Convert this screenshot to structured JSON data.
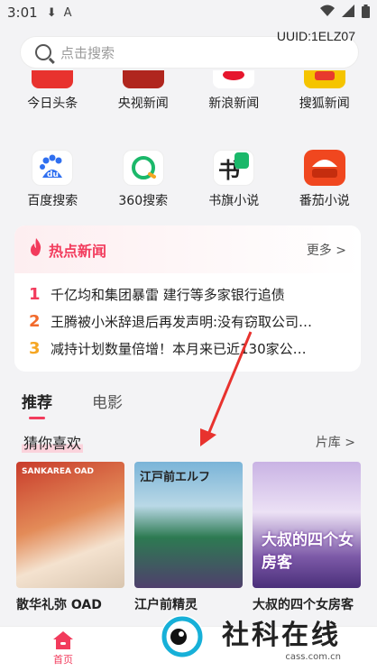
{
  "status_bar": {
    "time": "3:01",
    "download_icon": "download-icon",
    "a_icon": "A"
  },
  "search": {
    "placeholder": "点击搜索",
    "uuid": "UUID:1ELZ07"
  },
  "row1": [
    {
      "label": "今日头条",
      "color": "#e8322e",
      "glyph": "头条"
    },
    {
      "label": "央视新闻",
      "color": "#c0392b",
      "glyph": "新闻"
    },
    {
      "label": "新浪新闻",
      "color": "#ffffff",
      "glyph": "新浪"
    },
    {
      "label": "搜狐新闻",
      "color": "#f5c400",
      "glyph": "搜狐"
    }
  ],
  "row2": [
    {
      "label": "百度搜索",
      "color": "#2f6ff0",
      "glyph": "du"
    },
    {
      "label": "360搜索",
      "color": "#ffffff",
      "glyph": "360"
    },
    {
      "label": "书旗小说",
      "color": "#ffffff",
      "glyph": "书"
    },
    {
      "label": "番茄小说",
      "color": "#f0471f",
      "glyph": "番茄"
    }
  ],
  "hot_news": {
    "title": "热点新闻",
    "more": "更多 >",
    "items": [
      {
        "rank": "1",
        "text": "千亿均和集团暴雷 建行等多家银行追债",
        "color": "#f23b5c"
      },
      {
        "rank": "2",
        "text": "王腾被小米辞退后再发声明:没有窃取公司…",
        "color": "#f26a2b"
      },
      {
        "rank": "3",
        "text": "减持计划数量倍增！本月来已近130家公…",
        "color": "#f5a623"
      }
    ]
  },
  "tabs": [
    {
      "label": "推荐"
    },
    {
      "label": "电影"
    }
  ],
  "guess": {
    "title": "猜你喜欢",
    "library": "片库 >"
  },
  "cards": [
    {
      "title": "散华礼弥 OAD",
      "cover_text": "SANKAREA OAD"
    },
    {
      "title": "江户前精灵",
      "cover_text": "江戸前エルフ"
    },
    {
      "title": "大叔的四个女房客",
      "cover_text": "大叔的四个女房客"
    }
  ],
  "bottom_nav": {
    "home": "首页"
  },
  "watermark": {
    "name": "社科在线",
    "url": "cass.com.cn"
  },
  "accent": "#f23b5c"
}
